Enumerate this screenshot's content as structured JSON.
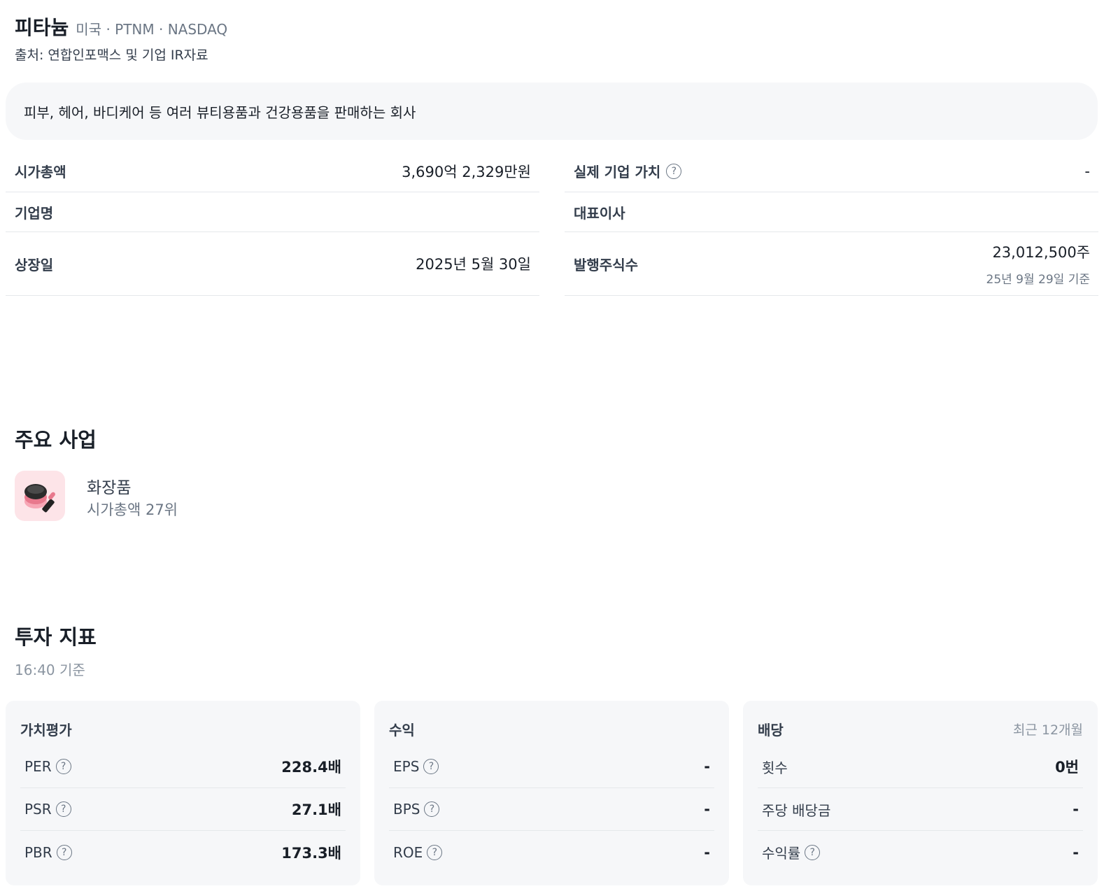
{
  "header": {
    "company_name": "피타늄",
    "meta": "미국 · PTNM · NASDAQ",
    "source": "출처: 연합인포맥스 및 기업 IR자료"
  },
  "description": "피부, 헤어, 바디케어 등 여러 뷰티용품과 건강용품을 판매하는 회사",
  "info": {
    "market_cap_label": "시가총액",
    "market_cap_value": "3,690억 2,329만원",
    "enterprise_value_label": "실제 기업 가치",
    "enterprise_value_value": "-",
    "company_label": "기업명",
    "company_value": "",
    "ceo_label": "대표이사",
    "ceo_value": "",
    "listing_date_label": "상장일",
    "listing_date_value": "2025년 5월 30일",
    "shares_label": "발행주식수",
    "shares_value": "23,012,500주",
    "shares_note": "25년 9월 29일 기준"
  },
  "business": {
    "title": "주요 사업",
    "icon": "cosmetics-icon",
    "name": "화장품",
    "rank": "시가총액 27위"
  },
  "indicators": {
    "title": "투자 지표",
    "timestamp": "16:40 기준",
    "valuation": {
      "title": "가치평가",
      "rows": [
        {
          "label": "PER",
          "value": "228.4배"
        },
        {
          "label": "PSR",
          "value": "27.1배"
        },
        {
          "label": "PBR",
          "value": "173.3배"
        }
      ]
    },
    "earnings": {
      "title": "수익",
      "rows": [
        {
          "label": "EPS",
          "value": "-"
        },
        {
          "label": "BPS",
          "value": "-"
        },
        {
          "label": "ROE",
          "value": "-"
        }
      ]
    },
    "dividend": {
      "title": "배당",
      "note": "최근 12개월",
      "rows": [
        {
          "label": "횟수",
          "value": "0번"
        },
        {
          "label": "주당 배당금",
          "value": "-"
        },
        {
          "label": "수익률",
          "value": "-"
        }
      ]
    }
  },
  "help_symbol": "?"
}
